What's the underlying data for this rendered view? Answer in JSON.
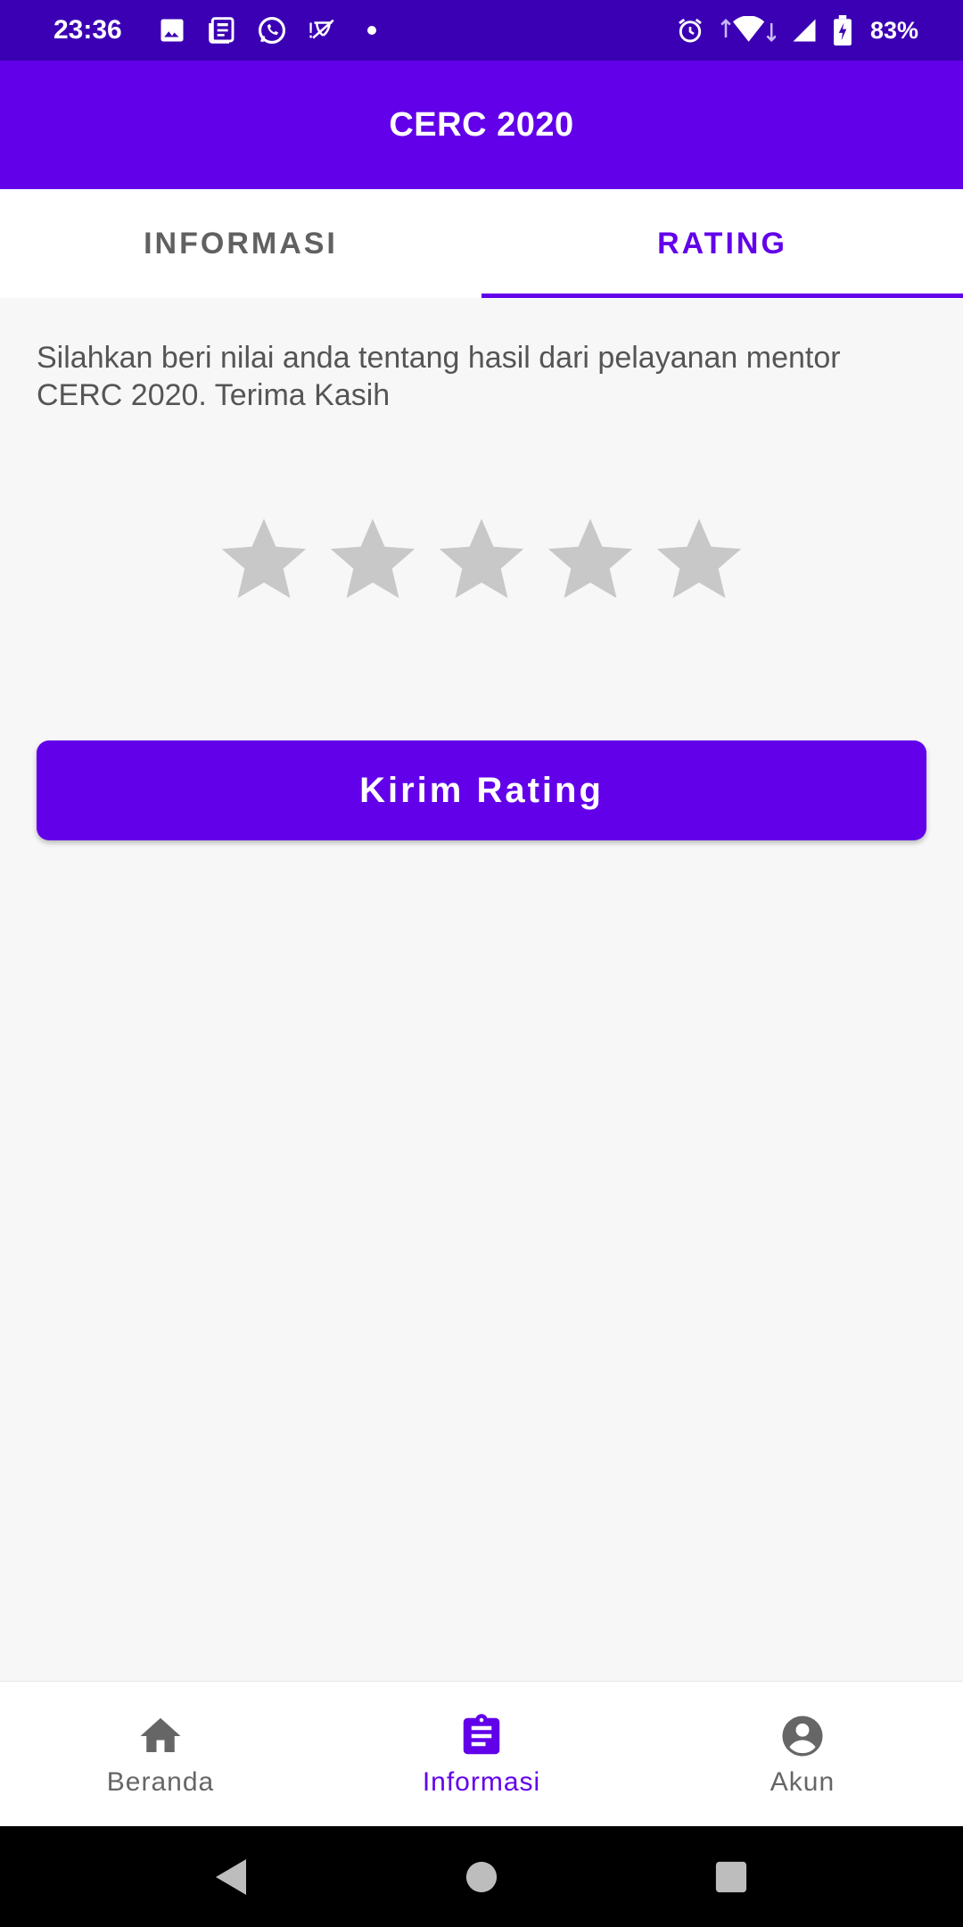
{
  "status_bar": {
    "time": "23:36",
    "battery": "83%",
    "left_icons": [
      "image-icon",
      "news-icon",
      "whatsapp-icon",
      "mute-icon",
      "dot-icon"
    ],
    "right_icons": [
      "alarm-icon",
      "wifi-icon",
      "signal-icon",
      "battery-icon"
    ]
  },
  "app_bar": {
    "title": "CERC 2020"
  },
  "tabs": [
    {
      "label": "INFORMASI",
      "active": false
    },
    {
      "label": "RATING",
      "active": true
    }
  ],
  "rating": {
    "description": "Silahkan beri nilai anda tentang hasil dari pelayanan mentor CERC 2020. Terima Kasih",
    "stars_total": 5,
    "stars_selected": 0,
    "star_color": "#c8c8c8",
    "submit_label": "Kirim Rating"
  },
  "bottom_nav": [
    {
      "label": "Beranda",
      "icon": "home-icon",
      "active": false
    },
    {
      "label": "Informasi",
      "icon": "clipboard-icon",
      "active": true
    },
    {
      "label": "Akun",
      "icon": "account-icon",
      "active": false
    }
  ],
  "colors": {
    "primary": "#6200ea",
    "status_bar": "#3b00b3",
    "inactive": "#666666"
  },
  "system_nav": [
    "back-icon",
    "home-circle-icon",
    "recents-icon"
  ]
}
